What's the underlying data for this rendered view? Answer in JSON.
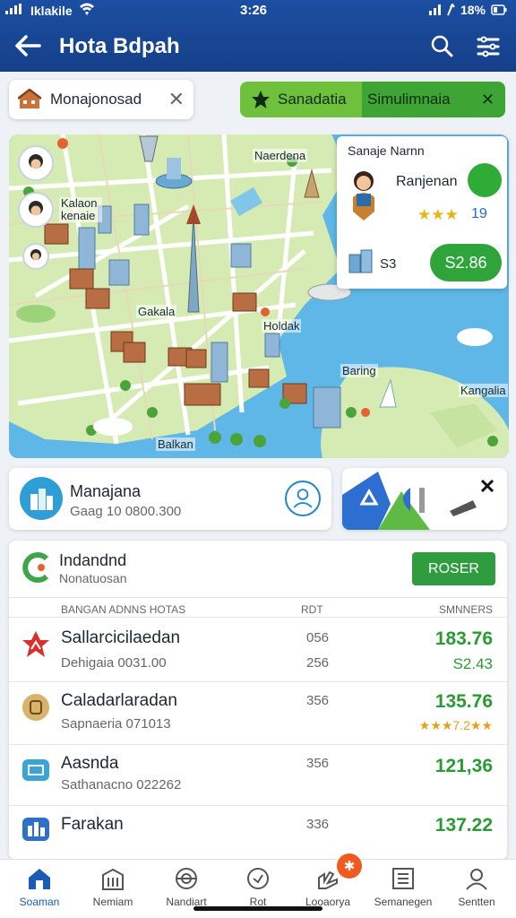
{
  "status_bar": {
    "carrier": "Iklakile",
    "time": "3:26",
    "battery": "18%"
  },
  "app_bar": {
    "title": "Hota Bdpah",
    "back_icon": "arrow-left-icon",
    "search_icon": "search-icon",
    "menu_icon": "menu-icon"
  },
  "search_chip": {
    "label": "Monajonosad"
  },
  "promo": {
    "left_label": "Sanadatia",
    "right_label": "Simulimnaia"
  },
  "map": {
    "labels": [
      "Naerdena",
      "Kalaon\nkenaie",
      "Gakala",
      "Holdak",
      "Baring",
      "Kangalia",
      "Balkan"
    ]
  },
  "profile_card": {
    "header": "Sanaje Narnn",
    "name": "Ranjenan",
    "stars": "★★★",
    "rating": "19",
    "price_label": "S3",
    "price": "S2.86"
  },
  "manager_card": {
    "title": "Manajana",
    "subtitle": "Gaag 10 0800.300"
  },
  "panel": {
    "title": "Indandnd",
    "subtitle": "Nonatuosan",
    "button": "ROSER",
    "columns": [
      "BANGAN ADNNS HOTAS",
      "RDT",
      "SMNNERS"
    ],
    "rows": [
      {
        "name": "Sallarcicilaedan",
        "sub": "Dehigaia 0031.00",
        "mid": "056",
        "mid2": "256",
        "value": "183.76",
        "value2": "S2.43",
        "icon": "hotel-red-icon",
        "stars": ""
      },
      {
        "name": "Caladarlaradan",
        "sub": "Sapnaeria 071013",
        "mid": "356",
        "mid2": "",
        "value": "135.76",
        "value2": "",
        "icon": "badge-gold-icon",
        "stars": "★★★7.2★★"
      },
      {
        "name": "Aasnda",
        "sub": "Sathanacno 022262",
        "mid": "356",
        "mid2": "",
        "value": "121,36",
        "value2": "",
        "icon": "monitor-icon",
        "stars": ""
      },
      {
        "name": "Farakan",
        "sub": "",
        "mid": "336",
        "mid2": "",
        "value": "137.22",
        "value2": "",
        "icon": "city-icon",
        "stars": ""
      }
    ]
  },
  "bottom_nav": {
    "items": [
      {
        "label": "Soaman",
        "icon": "home-icon"
      },
      {
        "label": "Nemiam",
        "icon": "building-icon"
      },
      {
        "label": "Nandiart",
        "icon": "target-icon"
      },
      {
        "label": "Rot",
        "icon": "clock-icon"
      },
      {
        "label": "Looaorya",
        "icon": "hand-icon"
      },
      {
        "label": "Semanegen",
        "icon": "list-icon"
      },
      {
        "label": "Sentten",
        "icon": "profile-icon"
      }
    ],
    "badge": "✱"
  }
}
